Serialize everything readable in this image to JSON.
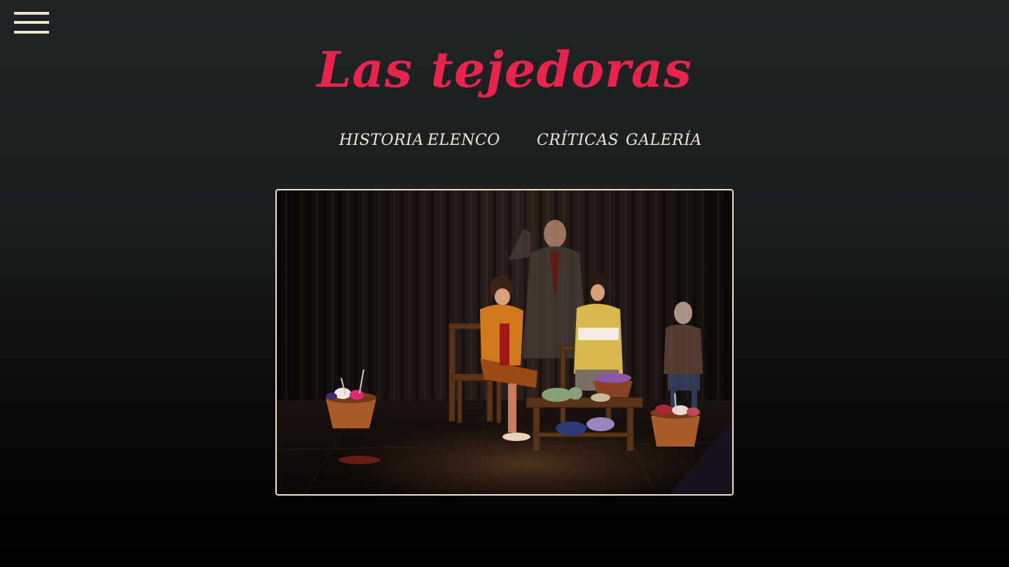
{
  "site": {
    "title": "Las tejedoras"
  },
  "menu": {
    "icon": "hamburger-menu-icon"
  },
  "nav": {
    "items": [
      {
        "label": "HISTORIA"
      },
      {
        "label": "ELENCO"
      },
      {
        "label": "CRÍTICAS"
      },
      {
        "label": "GALERÍA"
      }
    ]
  },
  "colors": {
    "title": "#e8244d",
    "nav_text": "#efe6d6",
    "frame_border": "#eee4d0",
    "background_top": "#1f2324",
    "background_bottom": "#000000"
  }
}
